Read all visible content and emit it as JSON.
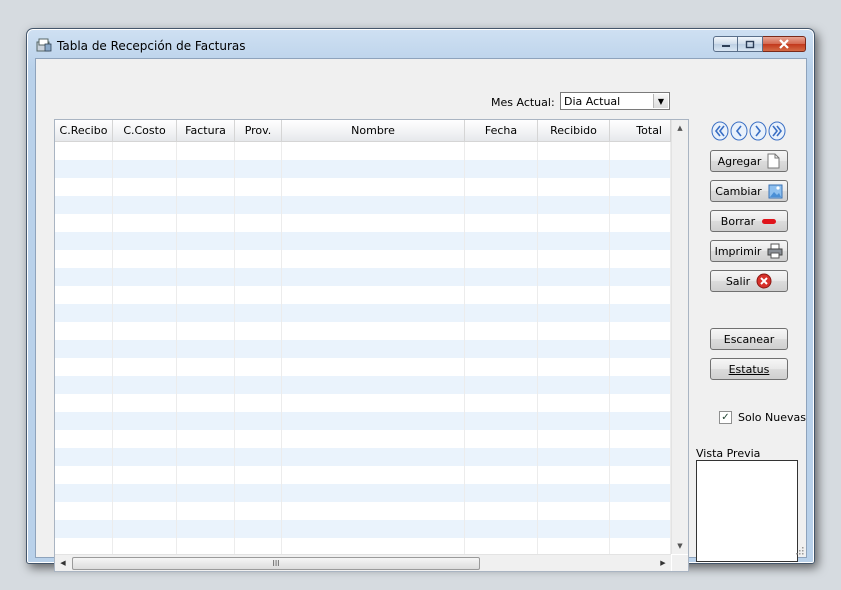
{
  "window": {
    "title": "Tabla de Recepción de Facturas"
  },
  "filter": {
    "label": "Mes Actual:",
    "selected": "Dia Actual"
  },
  "table": {
    "columns": [
      {
        "label": "C.Recibo",
        "align": "center"
      },
      {
        "label": "C.Costo",
        "align": "center"
      },
      {
        "label": "Factura",
        "align": "center"
      },
      {
        "label": "Prov.",
        "align": "center"
      },
      {
        "label": "Nombre",
        "align": "center"
      },
      {
        "label": "Fecha",
        "align": "center"
      },
      {
        "label": "Recibido",
        "align": "center"
      },
      {
        "label": "Total",
        "align": "right"
      }
    ],
    "rows": []
  },
  "buttons": {
    "agregar": "Agregar",
    "cambiar": "Cambiar",
    "borrar": "Borrar",
    "imprimir": "Imprimir",
    "salir": "Salir",
    "escanear": "Escanear",
    "estatus": "Estatus"
  },
  "options": {
    "solo_nuevas_label": "Solo Nuevas",
    "solo_nuevas_checked": true
  },
  "preview": {
    "label": "Vista Previa"
  },
  "scrollbar": {
    "thumb_grip": "III"
  },
  "colors": {
    "accent": "#3a6fc4",
    "close": "#d7302a",
    "row_alt": "#eaf3fc"
  }
}
